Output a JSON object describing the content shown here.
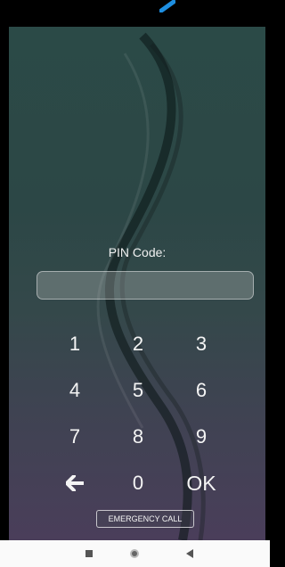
{
  "lockscreen": {
    "pin_label": "PIN Code:",
    "pin_value": "",
    "keys": [
      "1",
      "2",
      "3",
      "4",
      "5",
      "6",
      "7",
      "8",
      "9",
      "back",
      "0",
      "OK"
    ],
    "emergency_label": "EMERGENCY CALL"
  },
  "icons": {
    "back_key": "arrow-left-icon",
    "nav_recents": "square-icon",
    "nav_home": "circle-icon",
    "nav_back": "triangle-left-icon"
  },
  "colors": {
    "accent_status": "#1e8ee0",
    "navbar_bg": "#fafafa",
    "wallpaper_top": "#2b4a47",
    "wallpaper_bottom": "#4a3e5a"
  }
}
